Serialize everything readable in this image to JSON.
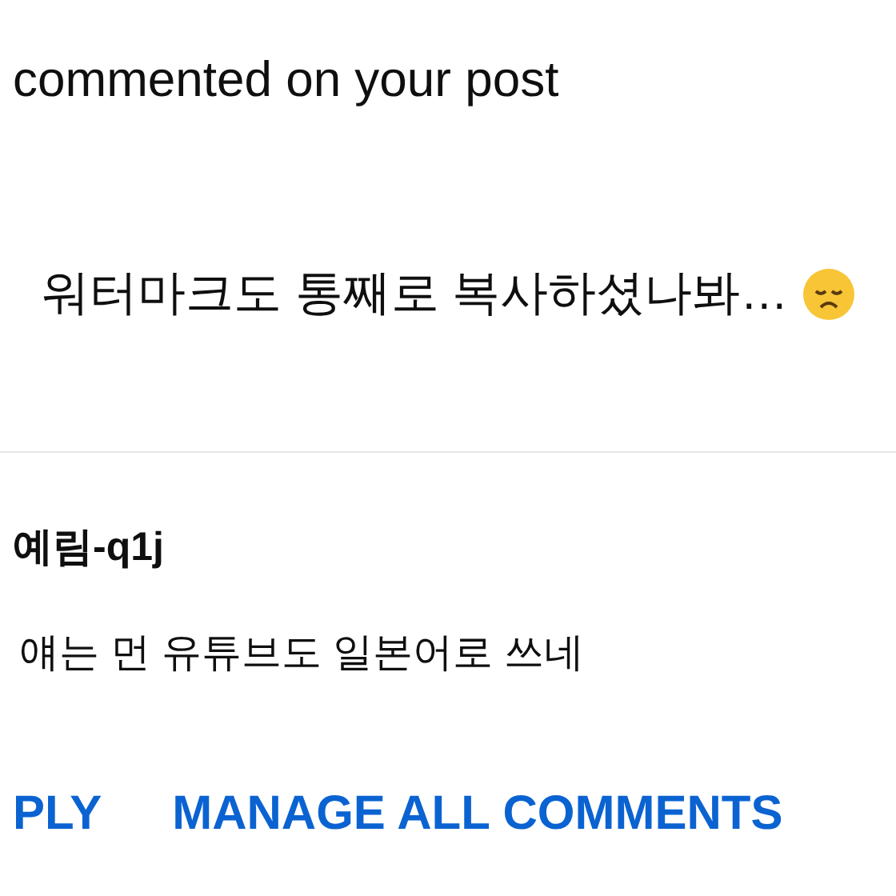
{
  "notification": {
    "headline": "commented on your post",
    "comment": "워터마크도 통째로 복사하셨나봐…"
  },
  "reply": {
    "author": "예림-q1j",
    "text": "얘는 먼 유튜브도 일본어로 쓰네"
  },
  "actions": [
    "PLY",
    "MANAGE ALL COMMENTS"
  ]
}
